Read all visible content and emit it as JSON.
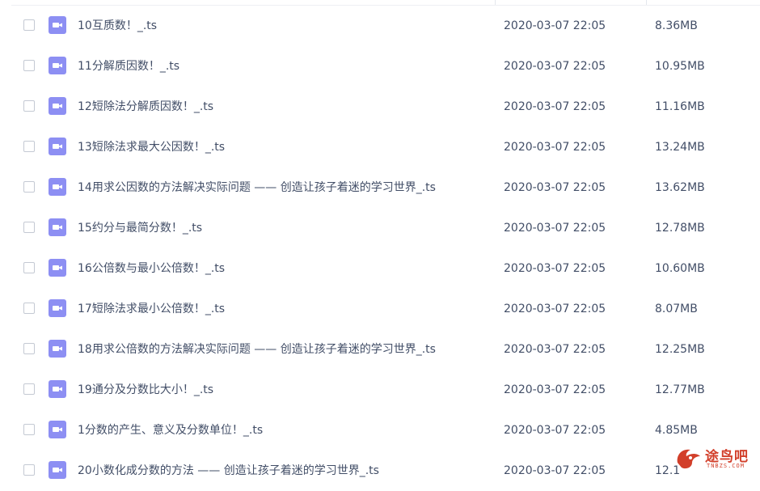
{
  "files": [
    {
      "name": "10互质数！_.ts",
      "date": "2020-03-07 22:05",
      "size": "8.36MB",
      "icon": "video-file-icon"
    },
    {
      "name": "11分解质因数！_.ts",
      "date": "2020-03-07 22:05",
      "size": "10.95MB",
      "icon": "video-file-icon"
    },
    {
      "name": "12短除法分解质因数！_.ts",
      "date": "2020-03-07 22:05",
      "size": "11.16MB",
      "icon": "video-file-icon"
    },
    {
      "name": "13短除法求最大公因数！_.ts",
      "date": "2020-03-07 22:05",
      "size": "13.24MB",
      "icon": "video-file-icon"
    },
    {
      "name": "14用求公因数的方法解决实际问题 —— 创造让孩子着迷的学习世界_.ts",
      "date": "2020-03-07 22:05",
      "size": "13.62MB",
      "icon": "video-file-icon"
    },
    {
      "name": "15约分与最简分数！_.ts",
      "date": "2020-03-07 22:05",
      "size": "12.78MB",
      "icon": "video-file-icon"
    },
    {
      "name": "16公倍数与最小公倍数！_.ts",
      "date": "2020-03-07 22:05",
      "size": "10.60MB",
      "icon": "video-file-icon"
    },
    {
      "name": "17短除法求最小公倍数！_.ts",
      "date": "2020-03-07 22:05",
      "size": "8.07MB",
      "icon": "video-file-icon"
    },
    {
      "name": "18用求公倍数的方法解决实际问题 —— 创造让孩子着迷的学习世界_.ts",
      "date": "2020-03-07 22:05",
      "size": "12.25MB",
      "icon": "video-file-icon"
    },
    {
      "name": "19通分及分数比大小！_.ts",
      "date": "2020-03-07 22:05",
      "size": "12.77MB",
      "icon": "video-file-icon"
    },
    {
      "name": "1分数的产生、意义及分数单位！_.ts",
      "date": "2020-03-07 22:05",
      "size": "4.85MB",
      "icon": "video-file-icon"
    },
    {
      "name": "20小数化成分数的方法 —— 创造让孩子着迷的学习世界_.ts",
      "date": "2020-03-07 22:05",
      "size": "12.1",
      "icon": "video-file-icon"
    }
  ],
  "watermark": {
    "text": "途鸟吧",
    "sub": "TNBZS.COM",
    "color": "#d23f2a"
  },
  "colors": {
    "icon_bg": "#8d8ff3",
    "text": "#424e67",
    "checkbox_border": "#c4c9d3"
  }
}
